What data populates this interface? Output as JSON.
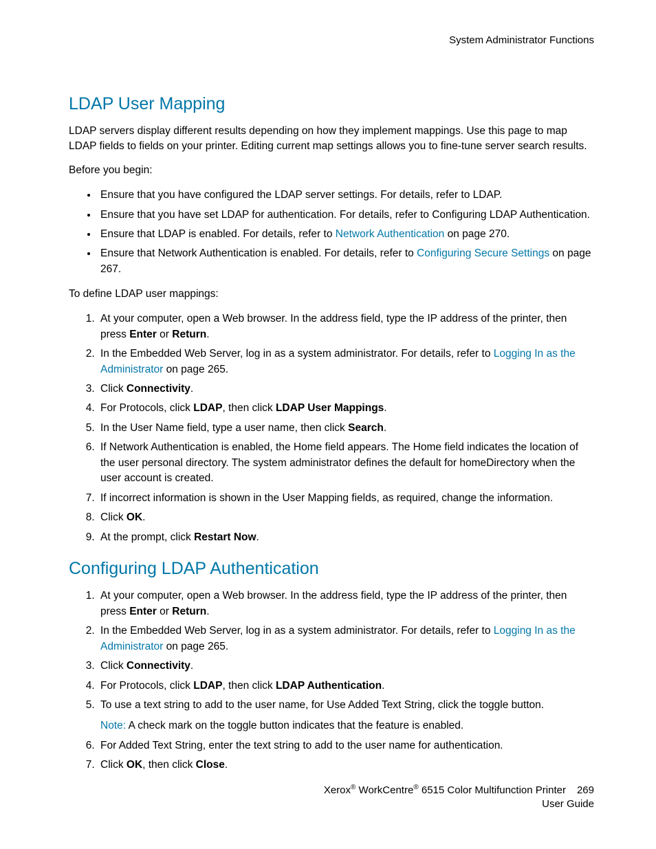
{
  "header": "System Administrator Functions",
  "section1": {
    "title": "LDAP User Mapping",
    "intro": "LDAP servers display different results depending on how they implement mappings. Use this page to map LDAP fields to fields on your printer. Editing current map settings allows you to fine-tune server search results.",
    "before_label": "Before you begin:",
    "bullets": {
      "b1": "Ensure that you have configured the LDAP server settings. For details, refer to LDAP.",
      "b2": "Ensure that you have set LDAP for authentication. For details, refer to Configuring LDAP Authentication.",
      "b3_a": "Ensure that LDAP is enabled. For details, refer to ",
      "b3_link": "Network Authentication",
      "b3_b": " on page 270.",
      "b4_a": "Ensure that Network Authentication is enabled. For details, refer to ",
      "b4_link": "Configuring Secure Settings",
      "b4_b": " on page 267."
    },
    "define_label": "To define LDAP user mappings:",
    "steps": {
      "s1_a": "At your computer, open a Web browser. In the address field, type the IP address of the printer, then press ",
      "s1_b1": "Enter",
      "s1_mid": " or ",
      "s1_b2": "Return",
      "s1_end": ".",
      "s2_a": "In the Embedded Web Server, log in as a system administrator. For details, refer to ",
      "s2_link": "Logging In as the Administrator",
      "s2_b": " on page 265.",
      "s3_a": "Click ",
      "s3_b": "Connectivity",
      "s3_c": ".",
      "s4_a": "For Protocols, click ",
      "s4_b1": "LDAP",
      "s4_mid": ", then click ",
      "s4_b2": "LDAP User Mappings",
      "s4_end": ".",
      "s5_a": "In the User Name field, type a user name, then click ",
      "s5_b": "Search",
      "s5_c": ".",
      "s6": "If Network Authentication is enabled, the Home field appears. The Home field indicates the location of the user personal directory. The system administrator defines the default for homeDirectory when the user account is created.",
      "s7": "If incorrect information is shown in the User Mapping fields, as required, change the information.",
      "s8_a": "Click ",
      "s8_b": "OK",
      "s8_c": ".",
      "s9_a": "At the prompt, click ",
      "s9_b": "Restart Now",
      "s9_c": "."
    }
  },
  "section2": {
    "title": "Configuring LDAP Authentication",
    "steps": {
      "s1_a": "At your computer, open a Web browser. In the address field, type the IP address of the printer, then press ",
      "s1_b1": "Enter",
      "s1_mid": " or ",
      "s1_b2": "Return",
      "s1_end": ".",
      "s2_a": "In the Embedded Web Server, log in as a system administrator. For details, refer to ",
      "s2_link": "Logging In as the Administrator",
      "s2_b": " on page 265.",
      "s3_a": "Click ",
      "s3_b": "Connectivity",
      "s3_c": ".",
      "s4_a": "For Protocols, click ",
      "s4_b1": "LDAP",
      "s4_mid": ", then click ",
      "s4_b2": "LDAP Authentication",
      "s4_end": ".",
      "s5": "To use a text string to add to the user name, for Use Added Text String, click the toggle button.",
      "s5_note_label": "Note:",
      "s5_note": " A check mark on the toggle button indicates that the feature is enabled.",
      "s6": "For Added Text String, enter the text string to add to the user name for authentication.",
      "s7_a": "Click ",
      "s7_b1": "OK",
      "s7_mid": ", then click ",
      "s7_b2": "Close",
      "s7_end": "."
    }
  },
  "footer": {
    "line1_a": "Xerox",
    "line1_b": " WorkCentre",
    "line1_c": " 6515 Color Multifunction Printer",
    "page_num": "269",
    "line2": "User Guide",
    "reg": "®"
  }
}
